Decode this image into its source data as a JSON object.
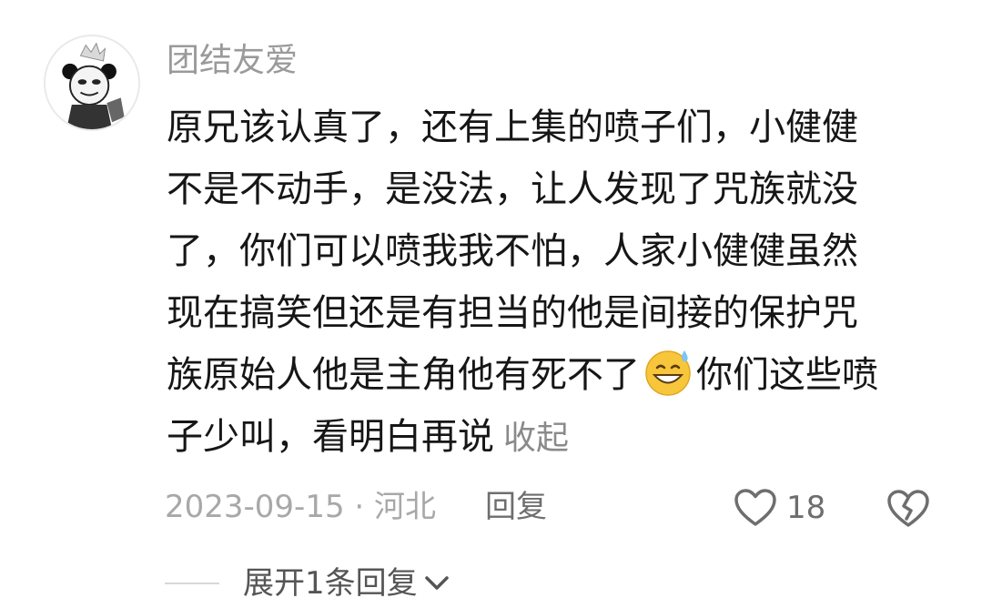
{
  "comment": {
    "username": "团结友爱",
    "body_lines": [
      "原兄该认真了，还有上集的喷子们，小健健",
      "不是不动手，是没法，让人发现了咒族就没",
      "了，你们可以喷我我不怕，人家小健健虽然",
      "现在搞笑但还是有担当的他是间接的保护咒",
      "族原始人他是主角他有死不了",
      "你们这些喷",
      "子少叫，看明白再说"
    ],
    "emoji": "grinning-sweat-emoji",
    "collapse_label": "收起",
    "date_location": "2023-09-15 · 河北",
    "reply_label": "回复",
    "like_count": "18",
    "expand_replies_label": "展开1条回复"
  },
  "colors": {
    "body_text": "#161616",
    "muted_text": "#9a9a9a",
    "icon": "#6e6e6e",
    "emoji_face": "#f7c63a"
  }
}
